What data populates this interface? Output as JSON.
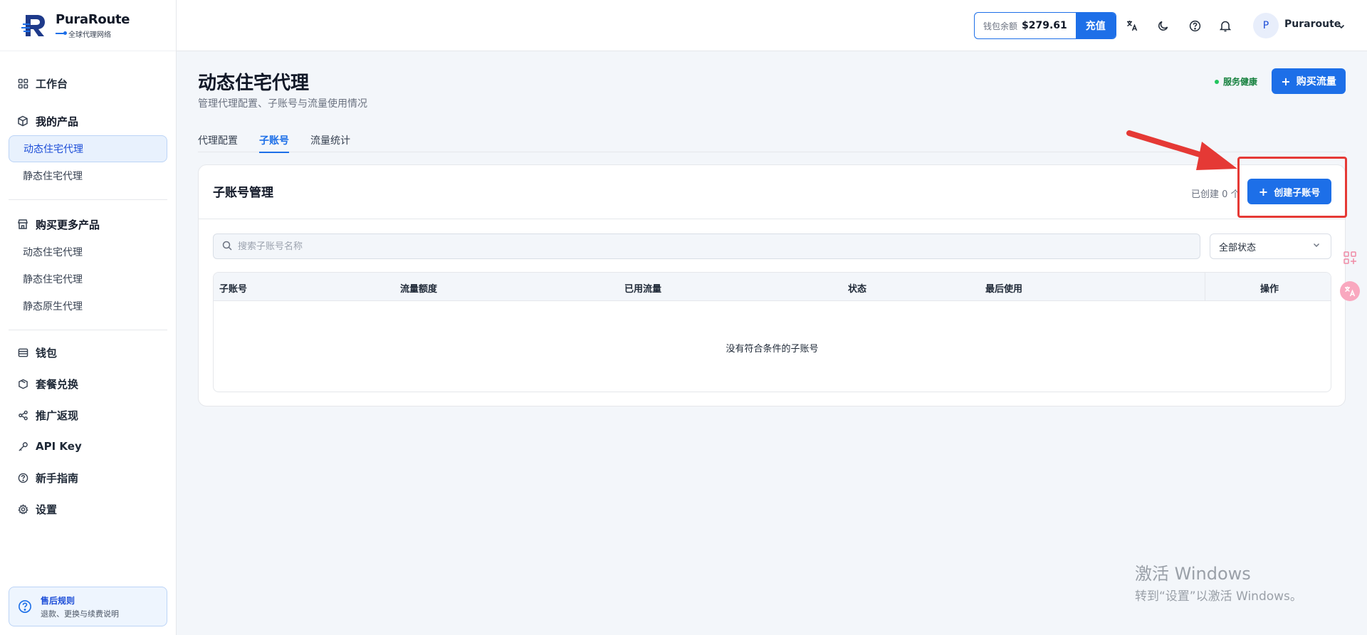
{
  "brand": {
    "name": "PuraRoute",
    "tagline": "全球代理网络"
  },
  "sidebar": {
    "dashboard": "工作台",
    "my_products": {
      "title": "我的产品",
      "items": [
        "动态住宅代理",
        "静态住宅代理"
      ]
    },
    "buy_more": {
      "title": "购买更多产品",
      "items": [
        "动态住宅代理",
        "静态住宅代理",
        "静态原生代理"
      ]
    },
    "menu": [
      "钱包",
      "套餐兑换",
      "推广返现",
      "API Key",
      "新手指南",
      "设置"
    ],
    "help": {
      "title": "售后规则",
      "desc": "退款、更换与续费说明"
    }
  },
  "topbar": {
    "wallet_label": "钱包余额",
    "wallet_amount": "$279.61",
    "recharge": "充值",
    "avatar_letter": "P",
    "user_name": "Puraroute"
  },
  "page": {
    "title": "动态住宅代理",
    "subtitle": "管理代理配置、子账号与流量使用情况",
    "health": "服务健康",
    "buy_button": "购买流量",
    "tabs": [
      "代理配置",
      "子账号",
      "流量统计"
    ],
    "active_tab": "子账号"
  },
  "subaccounts": {
    "title": "子账号管理",
    "created_label": "已创建 0 个",
    "create_button": "创建子账号",
    "search_placeholder": "搜索子账号名称",
    "status_filter": "全部状态",
    "columns": [
      "子账号",
      "流量额度",
      "已用流量",
      "状态",
      "最后使用",
      "操作"
    ],
    "empty_text": "没有符合条件的子账号"
  },
  "watermark": {
    "line1": "激活 Windows",
    "line2": "转到“设置”以激活 Windows。"
  },
  "colors": {
    "primary": "#1d6fe8",
    "annotation": "#e53935",
    "health": "#22c55e"
  }
}
